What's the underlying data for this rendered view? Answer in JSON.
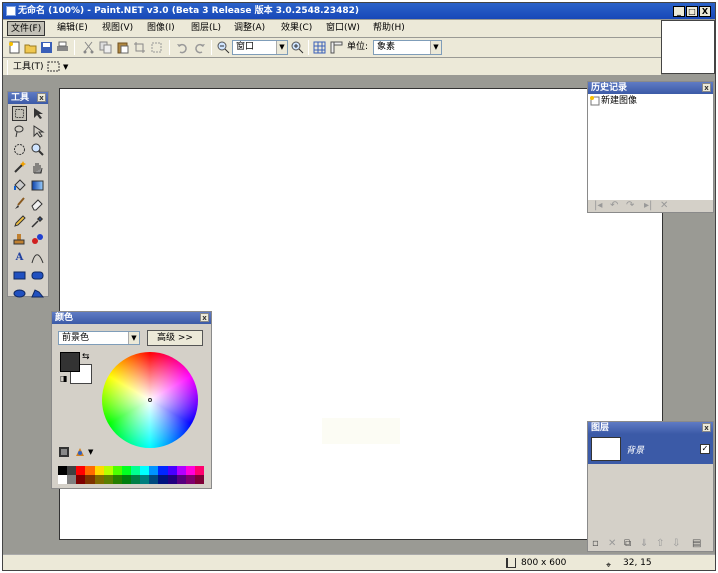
{
  "window": {
    "title": "无命名 (100%) - Paint.NET v3.0 (Beta 3 Release 版本 3.0.2548.23482)"
  },
  "caption_buttons": {
    "minimize": "_",
    "maximize": "□",
    "close": "X"
  },
  "menu": [
    {
      "label": "文件(F)"
    },
    {
      "label": "编辑(E)"
    },
    {
      "label": "视图(V)"
    },
    {
      "label": "图像(I)"
    },
    {
      "label": "图层(L)"
    },
    {
      "label": "调整(A)"
    },
    {
      "label": "效果(C)"
    },
    {
      "label": "窗口(W)"
    },
    {
      "label": "帮助(H)"
    }
  ],
  "toolbar": {
    "zoom_value": "窗口",
    "units_label": "单位:",
    "units_value": "象素"
  },
  "toolbar2": {
    "tools_label": "工具(T)"
  },
  "tools_panel": {
    "title": "工具"
  },
  "history_panel": {
    "title": "历史记录",
    "items": [
      "新建图像"
    ]
  },
  "layers_panel": {
    "title": "图层",
    "layer_name": "背景"
  },
  "colors_panel": {
    "title": "颜色",
    "mode_value": "前景色",
    "more_button": "高级 >>"
  },
  "status": {
    "image_size": "800 x 600",
    "coords": "32, 15"
  },
  "colors": {
    "accent": "#3b5aa7",
    "title_bar": "#1f4fbf",
    "chrome": "#ece9d8",
    "workspace": "#9a9a94"
  },
  "palette": [
    "#000000",
    "#404040",
    "#ff0000",
    "#ff6a00",
    "#ffd800",
    "#b6ff00",
    "#4cff00",
    "#00ff21",
    "#00ff90",
    "#00ffff",
    "#0094ff",
    "#0026ff",
    "#4800ff",
    "#b200ff",
    "#ff00dc",
    "#ff006e",
    "#ffffff",
    "#808080",
    "#7f0000",
    "#7f3300",
    "#7f6a00",
    "#5b7f00",
    "#267f00",
    "#007f0e",
    "#007f46",
    "#007f7f",
    "#004a7f",
    "#00137f",
    "#21007f",
    "#57007f",
    "#7f006e",
    "#7f0037"
  ]
}
